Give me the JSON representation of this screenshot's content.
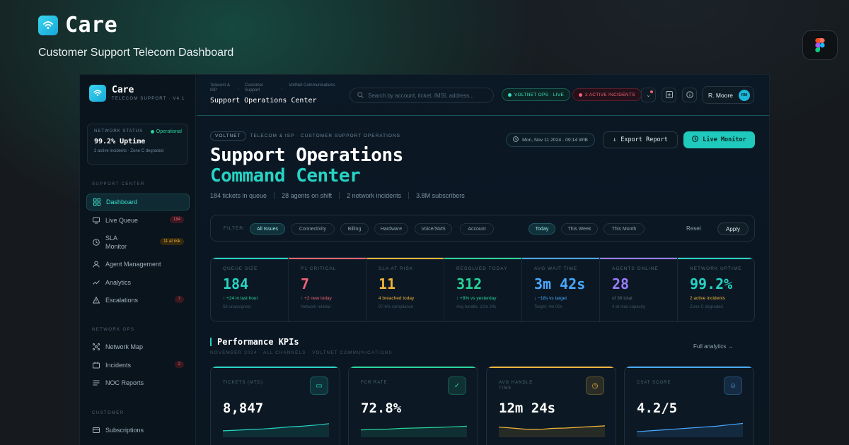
{
  "brand": {
    "name": "Care",
    "tagline": "Customer Support Telecom Dashboard"
  },
  "colors": {
    "accent": "#27d3c4",
    "critical": "#f06273",
    "warning": "#f0b43a",
    "success": "#28d39a",
    "info": "#4aa8ff",
    "purple": "#9b7cff"
  },
  "sidebar": {
    "title": "Care",
    "subtitle": "TELECOM SUPPORT · V4.1",
    "network": {
      "label": "NETWORK STATUS",
      "status": "Operational",
      "uptime": "99.2% Uptime",
      "note": "2 active incidents · Zone C degraded"
    },
    "sections": [
      {
        "label": "SUPPORT CENTER"
      },
      {
        "label": "NETWORK OPS"
      },
      {
        "label": "CUSTOMER"
      }
    ],
    "items": [
      {
        "label": "Dashboard",
        "icon": "grid-icon"
      },
      {
        "label": "Live Queue",
        "icon": "monitor-icon",
        "badge": "184"
      },
      {
        "label": "SLA Monitor",
        "icon": "clock-icon",
        "badge": "11 at risk"
      },
      {
        "label": "Agent Management",
        "icon": "user-icon"
      },
      {
        "label": "Analytics",
        "icon": "trend-icon"
      },
      {
        "label": "Escalations",
        "icon": "warning-icon",
        "badge": "7"
      },
      {
        "label": "Network Map",
        "icon": "network-icon"
      },
      {
        "label": "Incidents",
        "icon": "incident-icon",
        "badge": "2"
      },
      {
        "label": "NOC Reports",
        "icon": "report-icon"
      },
      {
        "label": "Subscriptions",
        "icon": "card-icon"
      }
    ]
  },
  "header": {
    "breadcrumb": [
      "Telecom & ISP",
      "Customer Support",
      "VoltNet Communications"
    ],
    "page_name": "Support Operations Center",
    "search_placeholder": "Search by account, ticket, IMSI, address...",
    "ops_pill": "VOLTNET OPS · LIVE",
    "incident_pill": "2 ACTIVE INCIDENTS",
    "user_name": "R. Moore",
    "user_initials": "RM"
  },
  "hero": {
    "chip": "VOLTNET",
    "tag": "TELECOM & ISP · CUSTOMER SUPPORT OPERATIONS",
    "title_line1": "Support Operations",
    "title_line2": "Command Center",
    "stats": [
      "184 tickets in queue",
      "28 agents on shift",
      "2 network incidents",
      "3.8M subscribers"
    ],
    "date": "Mon, Nov 11 2024 · 09:14 WIB",
    "export_label": "Export Report",
    "live_label": "Live Monitor"
  },
  "filters": {
    "label": "FILTER:",
    "categories": [
      "All Issues",
      "Connectivity",
      "Billing",
      "Hardware",
      "Voice/SMS",
      "Account"
    ],
    "periods": [
      "Today",
      "This Week",
      "This Month"
    ],
    "reset": "Reset",
    "apply": "Apply"
  },
  "metrics": [
    {
      "label": "QUEUE SIZE",
      "value": "184",
      "delta": "↑ +24 in last hour",
      "note": "58 unassigned",
      "color": "#27d3c4",
      "delta_color": "#28d39a"
    },
    {
      "label": "P1 CRITICAL",
      "value": "7",
      "delta": "↑ +2 new today",
      "note": "Network related",
      "color": "#f06273",
      "delta_color": "#f06273"
    },
    {
      "label": "SLA AT RISK",
      "value": "11",
      "delta": "4 breached today",
      "note": "97.6% compliance",
      "color": "#f0b43a",
      "delta_color": "#f0b43a"
    },
    {
      "label": "RESOLVED TODAY",
      "value": "312",
      "delta": "↑ +8% vs yesterday",
      "note": "Avg handle: 12m 24s",
      "color": "#28d39a",
      "delta_color": "#28d39a"
    },
    {
      "label": "AVG WAIT TIME",
      "value": "3m 42s",
      "delta": "↓ −18s vs target",
      "note": "Target: 4m 00s",
      "color": "#4aa8ff",
      "delta_color": "#4aa8ff"
    },
    {
      "label": "AGENTS ONLINE",
      "value": "28",
      "delta": "of 36 total",
      "note": "4 at max capacity",
      "color": "#9b7cff",
      "delta_color": "#5a6e7c"
    },
    {
      "label": "NETWORK UPTIME",
      "value": "99.2%",
      "delta": "2 active incidents",
      "note": "Zone C degraded",
      "color": "#27d3c4",
      "delta_color": "#f0b43a"
    }
  ],
  "performance": {
    "title": "Performance KPIs",
    "subtitle": "NOVEMBER 2024 · ALL CHANNELS · VOLTNET COMMUNICATIONS",
    "full_link": "Full analytics →",
    "cards": [
      {
        "label": "TICKETS (MTD)",
        "value": "8,847",
        "icon": "ticket-icon",
        "color": "#27d3c4",
        "trend": [
          0.35,
          0.38,
          0.42,
          0.45,
          0.5,
          0.56,
          0.6,
          0.66,
          0.74
        ]
      },
      {
        "label": "FCR RATE",
        "value": "72.8%",
        "icon": "check-icon",
        "color": "#28d39a",
        "trend": [
          0.4,
          0.42,
          0.44,
          0.48,
          0.5,
          0.52,
          0.54,
          0.57,
          0.6
        ]
      },
      {
        "label": "AVG HANDLE TIME",
        "value": "12m 24s",
        "icon": "timer-icon",
        "color": "#f0b43a",
        "trend": [
          0.55,
          0.5,
          0.44,
          0.42,
          0.48,
          0.5,
          0.54,
          0.58,
          0.62
        ]
      },
      {
        "label": "CSAT SCORE",
        "value": "4.2/5",
        "icon": "smile-icon",
        "color": "#4aa8ff",
        "trend": [
          0.3,
          0.35,
          0.4,
          0.45,
          0.5,
          0.55,
          0.6,
          0.68,
          0.75
        ]
      }
    ]
  }
}
